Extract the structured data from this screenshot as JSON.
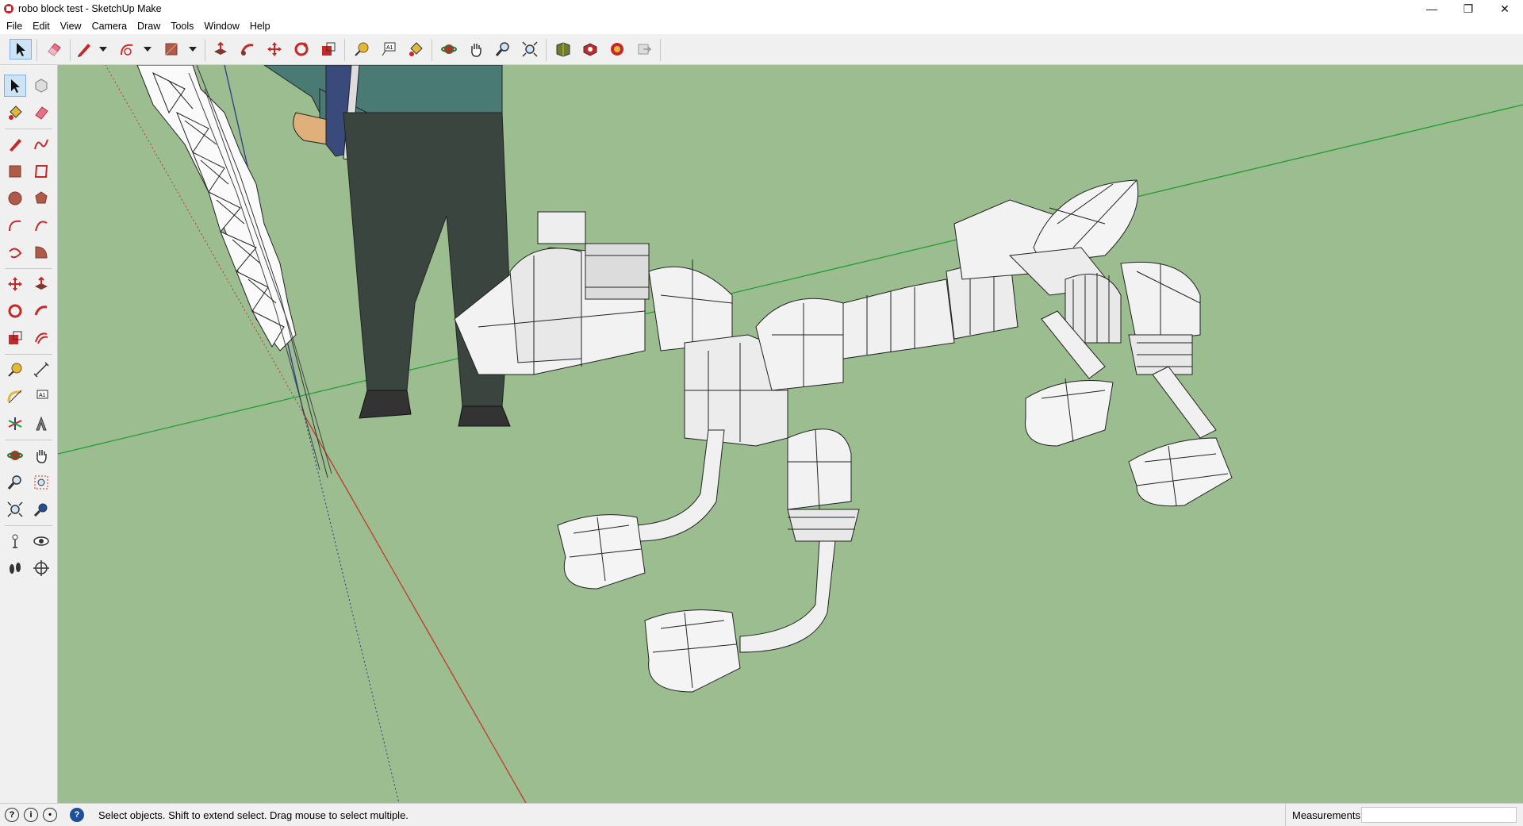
{
  "window": {
    "title": "robo block test - SketchUp Make",
    "minimize": "—",
    "restore": "❐",
    "close": "✕"
  },
  "menu": [
    "File",
    "Edit",
    "View",
    "Camera",
    "Draw",
    "Tools",
    "Window",
    "Help"
  ],
  "toolbar": {
    "tools": [
      "select-icon",
      "eraser-icon",
      "pencil-icon",
      "arc-icon",
      "rectangle-icon",
      "push-pull-icon",
      "follow-me-icon",
      "move-icon",
      "rotate-icon",
      "scale-icon",
      "tape-measure-icon",
      "text-icon",
      "paint-bucket-icon",
      "orbit-icon",
      "pan-icon",
      "zoom-icon",
      "zoom-extents-icon",
      "3d-warehouse-icon",
      "extension-warehouse-icon",
      "layout-icon",
      "send-to-layout-icon"
    ],
    "active": "select-icon"
  },
  "left_toolbar": {
    "tools": [
      "select-icon",
      "make-component-icon",
      "paint-bucket-icon",
      "eraser-icon",
      "pencil-icon",
      "freehand-icon",
      "rectangle-icon",
      "rotated-rectangle-icon",
      "circle-icon",
      "polygon-icon",
      "arc-icon",
      "2-point-arc-icon",
      "3-point-arc-icon",
      "pie-icon",
      "move-icon",
      "push-pull-icon",
      "rotate-icon",
      "follow-me-icon",
      "scale-icon",
      "offset-icon",
      "tape-measure-icon",
      "dimension-icon",
      "protractor-icon",
      "text-icon",
      "axes-icon",
      "3d-text-icon",
      "orbit-icon",
      "pan-icon",
      "zoom-icon",
      "zoom-window-icon",
      "zoom-extents-icon",
      "previous-view-icon",
      "position-camera-icon",
      "look-around-icon",
      "walk-icon",
      "section-plane-icon"
    ],
    "active": "select-icon"
  },
  "statusbar": {
    "message": "Select objects. Shift to extend select. Drag mouse to select multiple.",
    "measurements_label": "Measurements",
    "measurements_value": ""
  },
  "colors": {
    "ground": "#9bbd8f",
    "axis_red": "#c0392b",
    "axis_green": "#1f9e2f",
    "axis_blue": "#2e3a8c"
  }
}
